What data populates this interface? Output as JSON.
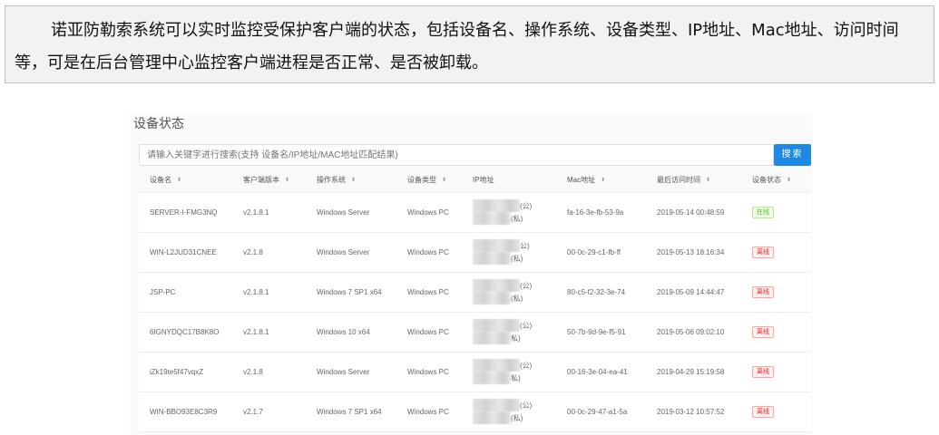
{
  "intro": {
    "text": "诺亚防勒索系统可以实时监控受保护客户端的状态，包括设备名、操作系统、设备类型、IP地址、Mac地址、访问时间等，可是在后台管理中心监控客户端进程是否正常、是否被卸载。"
  },
  "panel": {
    "title": "设备状态",
    "search_placeholder": "请输入关键字进行搜索(支持 设备名/IP地址/MAC地址匹配结果)",
    "search_button": "搜索"
  },
  "table": {
    "columns": [
      "设备名",
      "客户端版本",
      "操作系统",
      "设备类型",
      "IP地址",
      "Mac地址",
      "最后访问时间",
      "设备状态"
    ],
    "sortable": [
      true,
      true,
      true,
      true,
      false,
      true,
      true,
      true
    ],
    "rows": [
      {
        "name": "SERVER-I-FMG3NQ",
        "version": "v2.1.8.1",
        "os": "Windows Server",
        "type": "Windows PC",
        "ip_public_tag": "(公)",
        "ip_private_tag": "(私)",
        "mac": "fa-16-3e-fb-53-9a",
        "last_access": "2019-05-14 00:48:59",
        "status": "在线",
        "status_kind": "online"
      },
      {
        "name": "WIN-L2JUD31CNEE",
        "version": "v2.1.8",
        "os": "Windows Server",
        "type": "Windows PC",
        "ip_public_tag": "公)",
        "ip_private_tag": "(私)",
        "mac": "00-0c-29-c1-fb-ff",
        "last_access": "2019-05-13 18:16:34",
        "status": "离线",
        "status_kind": "offline"
      },
      {
        "name": "JSP-PC",
        "version": "v2.1.8.1",
        "os": "Windows 7 SP1 x64",
        "type": "Windows PC",
        "ip_public_tag": "(公)",
        "ip_private_tag": "(私)",
        "mac": "80-c5-f2-32-3e-74",
        "last_access": "2019-05-09 14:44:47",
        "status": "离线",
        "status_kind": "offline"
      },
      {
        "name": "6IGNYDQC17B8K8O",
        "version": "v2.1.8.1",
        "os": "Windows 10 x64",
        "type": "Windows PC",
        "ip_public_tag": "(公)",
        "ip_private_tag": "私)",
        "mac": "50-7b-9d-9e-f5-91",
        "last_access": "2019-05-06 09:02:10",
        "status": "离线",
        "status_kind": "offline"
      },
      {
        "name": "iZk19te5f47vqxZ",
        "version": "v2.1.8",
        "os": "Windows Server",
        "type": "Windows PC",
        "ip_public_tag": "(公)",
        "ip_private_tag": "私)",
        "mac": "00-16-3e-04-ea-41",
        "last_access": "2019-04-29 15:19:58",
        "status": "离线",
        "status_kind": "offline"
      },
      {
        "name": "WIN-BBO93E8C3R9",
        "version": "v2.1.7",
        "os": "Windows 7 SP1 x64",
        "type": "Windows PC",
        "ip_public_tag": "(公)",
        "ip_private_tag": "(私)",
        "mac": "00-0c-29-47-a1-5a",
        "last_access": "2019-03-12 10:57:52",
        "status": "离线",
        "status_kind": "offline"
      }
    ]
  },
  "colors": {
    "accent": "#1e88e5",
    "online": "#52c41a",
    "offline": "#f5222d"
  },
  "icons": {
    "sort": "sort-icon"
  }
}
